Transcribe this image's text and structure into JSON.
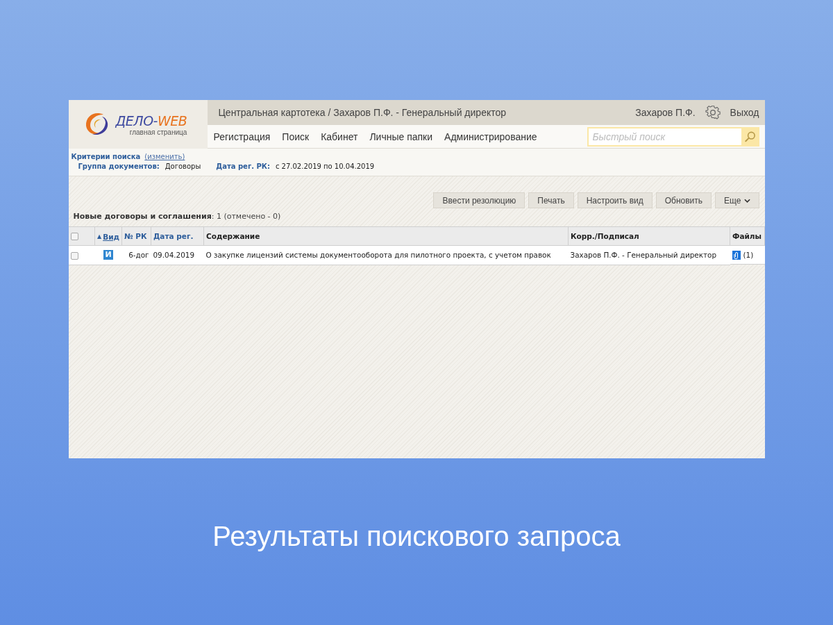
{
  "logo": {
    "title_part1": "ДЕЛО-",
    "title_part2": "WEB",
    "subtitle": "главная страница"
  },
  "header": {
    "breadcrumb": "Центральная картотека / Захаров П.Ф. - Генеральный директор",
    "user": "Захаров П.Ф.",
    "logout": "Выход"
  },
  "nav": [
    {
      "label": "Регистрация"
    },
    {
      "label": "Поиск"
    },
    {
      "label": "Кабинет"
    },
    {
      "label": "Личные папки"
    },
    {
      "label": "Администрирование"
    }
  ],
  "search": {
    "placeholder": "Быстрый поиск"
  },
  "criteria": {
    "title": "Критерии поиска",
    "change_link": "(изменить)",
    "fields": [
      {
        "label": "Группа документов:",
        "value": "Договоры"
      },
      {
        "label": "Дата рег. РК:",
        "value": "с 27.02.2019 по 10.04.2019"
      }
    ]
  },
  "toolbar": [
    {
      "label": "Ввести резолюцию"
    },
    {
      "label": "Печать"
    },
    {
      "label": "Настроить вид"
    },
    {
      "label": "Обновить"
    },
    {
      "label": "Еще",
      "kind": "menu"
    }
  ],
  "list_title": "**Новые договоры и соглашения**: 1 (отмечено - 0)",
  "table": {
    "select_all_checked": false,
    "columns": [
      {
        "label": "Вид",
        "kind": "sorted",
        "sort_mark": "▲"
      },
      {
        "label": "№ РК",
        "kind": "sortable"
      },
      {
        "label": "Дата рег.",
        "kind": "sortable"
      },
      {
        "label": "Содержание",
        "kind": "plain"
      },
      {
        "label": "Корр./Подписал",
        "kind": "plain"
      },
      {
        "label": "Файлы",
        "kind": "plain"
      }
    ],
    "rows": [
      {
        "checked": false,
        "type_badge": "И",
        "number": "6-дог",
        "date": "09.04.2019",
        "content": "О закупке лицензий системы документооборота для пилотного проекта, с учетом правок",
        "signer": "Захаров П.Ф. - Генеральный директор",
        "files": "(1)"
      }
    ]
  },
  "caption": "Результаты поискового запроса"
}
